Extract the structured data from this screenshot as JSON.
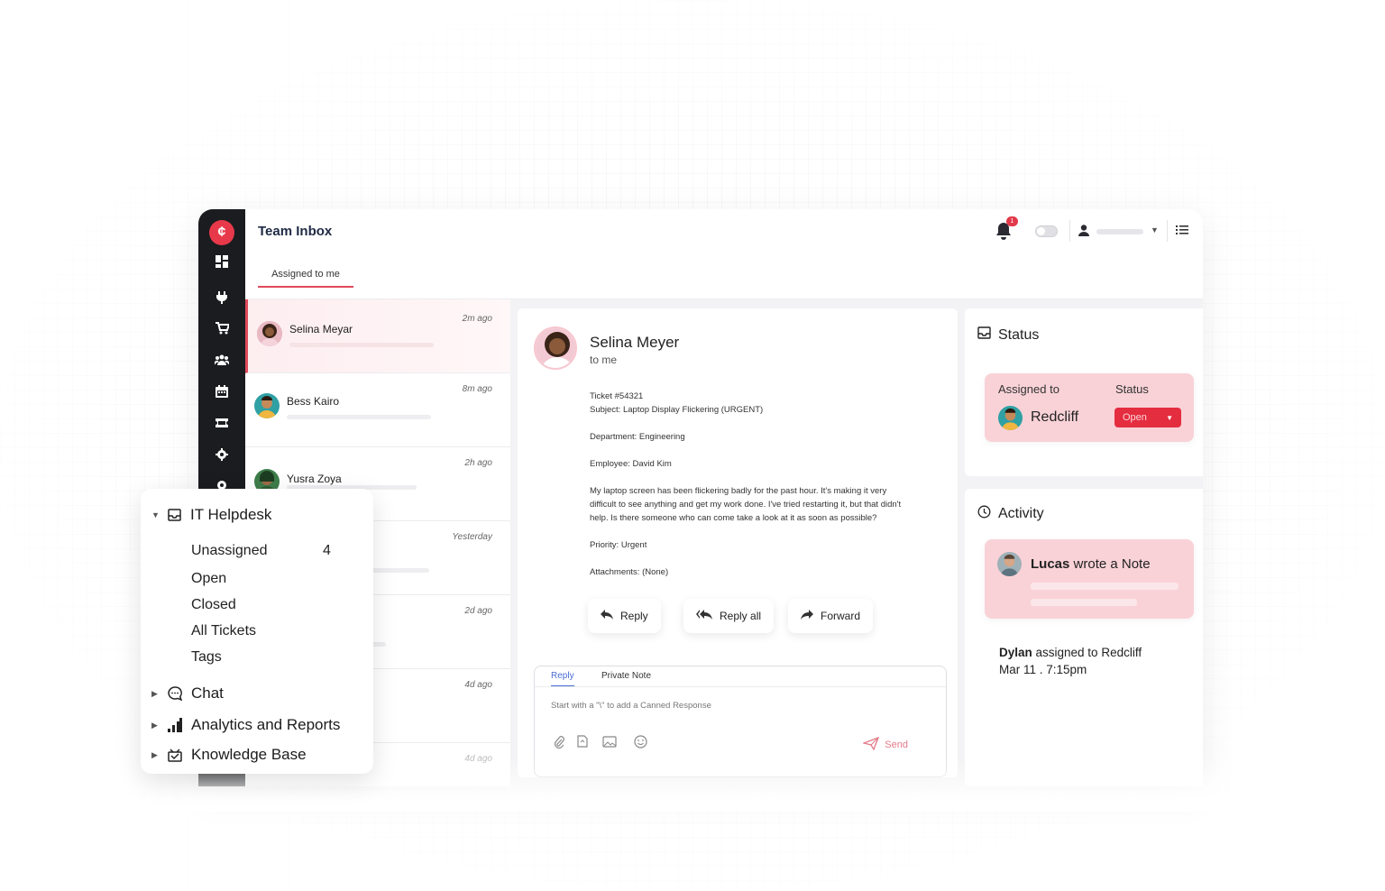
{
  "app": {
    "title": "Team Inbox",
    "logo_letter": "¢"
  },
  "tabs": {
    "assigned": "Assigned to me"
  },
  "notifications": {
    "count": "1"
  },
  "tickets": [
    {
      "name": "Selina Meyar",
      "time": "2m ago",
      "active": true
    },
    {
      "name": "Bess Kairo",
      "time": "8m ago"
    },
    {
      "name": "Yusra Zoya",
      "time": "2h ago"
    },
    {
      "name": "",
      "time": "Yesterday"
    },
    {
      "name": "",
      "time": "2d ago"
    },
    {
      "name": "",
      "time": "4d ago"
    },
    {
      "name": "",
      "time": "4d ago"
    }
  ],
  "message": {
    "from": "Selina Meyer",
    "to": "to me",
    "ticket": "Ticket #54321",
    "subject": "Subject: Laptop Display Flickering (URGENT)",
    "department": "Department: Engineering",
    "employee": "Employee: David Kim",
    "body_1": "My laptop screen has been flickering badly for the past hour. It's making it very",
    "body_2": "difficult to see anything and get my work done. I've tried restarting it, but that didn't",
    "body_3": "help. Is there someone who can come take a look at it as soon as possible?",
    "priority": "Priority: Urgent",
    "attachments": "Attachments: (None)"
  },
  "actions": {
    "reply": "Reply",
    "reply_all": "Reply all",
    "forward": "Forward"
  },
  "compose": {
    "tab_reply": "Reply",
    "tab_note": "Private Note",
    "hint": "Start with a \"\\\" to add a Canned Response",
    "send": "Send"
  },
  "status_panel": {
    "title": "Status",
    "assigned_label": "Assigned to",
    "status_label": "Status",
    "assignee": "Redcliff",
    "status_value": "Open"
  },
  "activity_panel": {
    "title": "Activity",
    "note_actor": "Lucas",
    "note_text": " wrote a Note",
    "event_actor": "Dylan",
    "event_text": " assigned to Redcliff",
    "event_time": "Mar 11 . 7:15pm"
  },
  "nav": {
    "group": "IT Helpdesk",
    "unassigned": "Unassigned",
    "unassigned_count": "4",
    "open": "Open",
    "closed": "Closed",
    "all": "All Tickets",
    "tags": "Tags",
    "chat": "Chat",
    "analytics": "Analytics and Reports",
    "kb": "Knowledge Base"
  },
  "colors": {
    "accent": "#e04a5a",
    "rail": "#1b1c20",
    "pink": "#f9d2d7",
    "link": "#4a6cd4"
  }
}
